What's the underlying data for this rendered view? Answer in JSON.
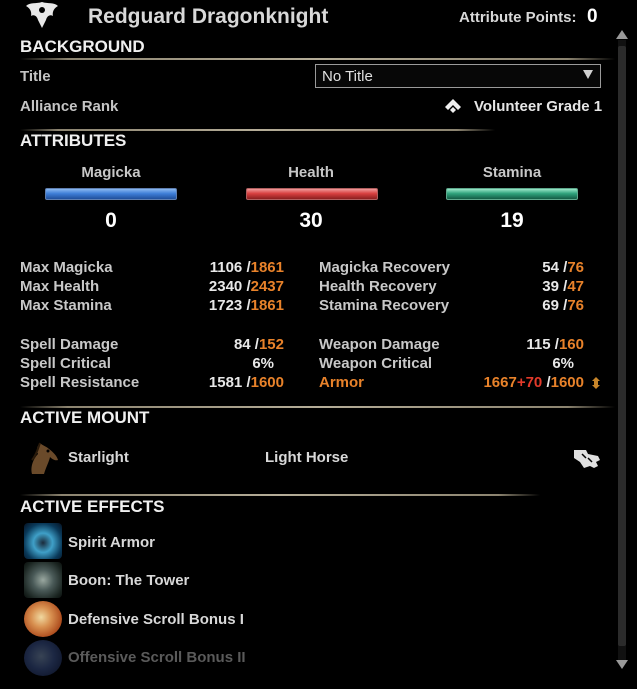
{
  "header": {
    "title": "Redguard Dragonknight",
    "attribute_points_label": "Attribute Points:",
    "attribute_points_value": "0"
  },
  "background": {
    "heading": "BACKGROUND",
    "title_label": "Title",
    "title_value": "No Title",
    "alliance_rank_label": "Alliance Rank",
    "alliance_rank_value": "Volunteer Grade 1"
  },
  "attributes": {
    "heading": "ATTRIBUTES",
    "items": [
      {
        "name": "Magicka",
        "value": "0",
        "color": "#3f7fd8"
      },
      {
        "name": "Health",
        "value": "30",
        "color": "#d84040"
      },
      {
        "name": "Stamina",
        "value": "19",
        "color": "#2fa37c"
      }
    ]
  },
  "stats": {
    "left": [
      {
        "label": "Max Magicka",
        "value": "1106",
        "cap": "1861"
      },
      {
        "label": "Max Health",
        "value": "2340",
        "cap": "2437"
      },
      {
        "label": "Max Stamina",
        "value": "1723",
        "cap": "1861"
      },
      {
        "label": "Spell Damage",
        "value": "84",
        "cap": "152"
      },
      {
        "label": "Spell Critical",
        "value": "6%",
        "cap": ""
      },
      {
        "label": "Spell Resistance",
        "value": "1581",
        "cap": "1600"
      }
    ],
    "right": [
      {
        "label": "Magicka Recovery",
        "value": "54",
        "cap": "76"
      },
      {
        "label": "Health Recovery",
        "value": "39",
        "cap": "47"
      },
      {
        "label": "Stamina Recovery",
        "value": "69",
        "cap": "76"
      },
      {
        "label": "Weapon Damage",
        "value": "115",
        "cap": "160"
      },
      {
        "label": "Weapon Critical",
        "value": "6%",
        "cap": ""
      }
    ],
    "armor": {
      "label": "Armor",
      "value": "1667",
      "bonus": "+70",
      "cap": "1600"
    }
  },
  "mount": {
    "heading": "ACTIVE MOUNT",
    "name": "Starlight",
    "type": "Light Horse"
  },
  "effects": {
    "heading": "ACTIVE EFFECTS",
    "items": [
      {
        "name": "Spirit Armor",
        "icon": "spirit-armor-icon"
      },
      {
        "name": "Boon: The Tower",
        "icon": "boon-tower-icon"
      },
      {
        "name": "Defensive Scroll Bonus I",
        "icon": "defensive-scroll-icon"
      },
      {
        "name": "Offensive Scroll Bonus II",
        "icon": "offensive-scroll-icon"
      }
    ]
  }
}
